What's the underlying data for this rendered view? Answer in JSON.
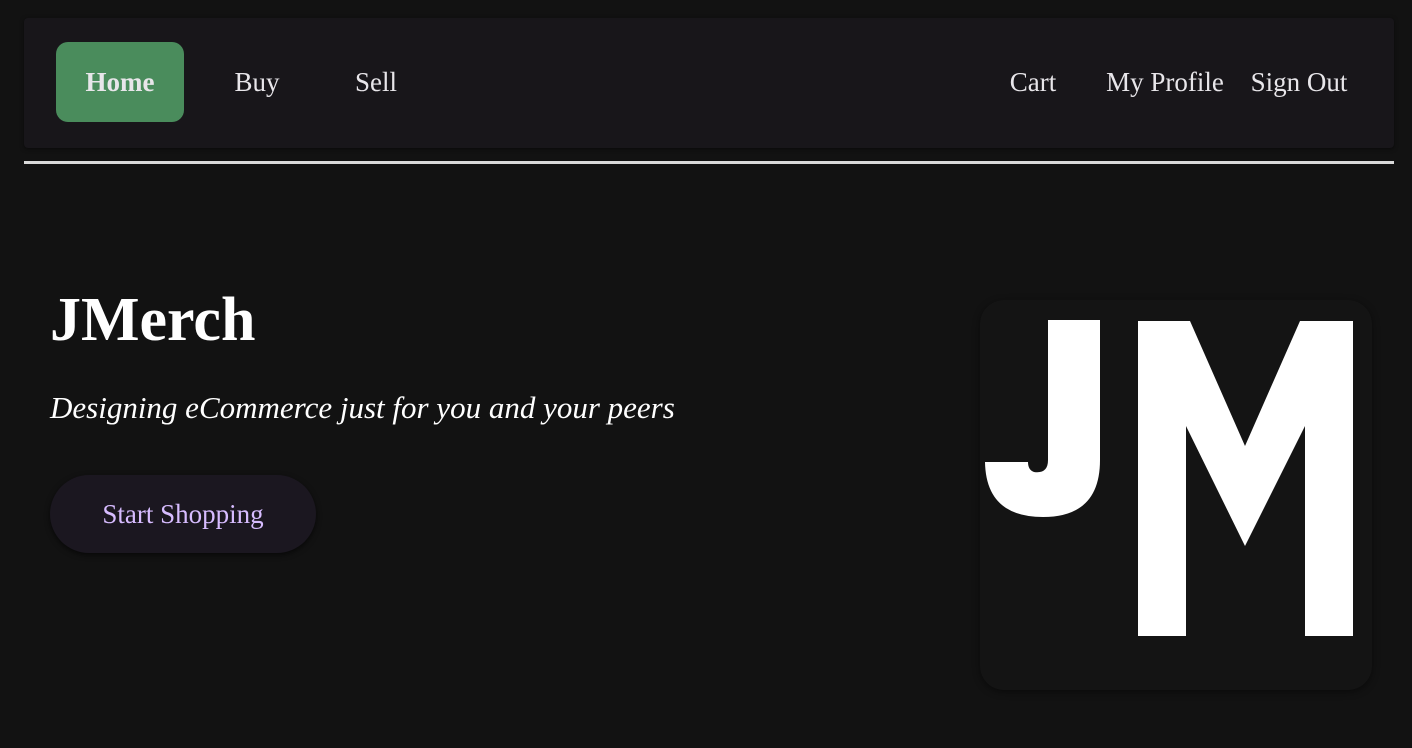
{
  "nav": {
    "home": "Home",
    "buy": "Buy",
    "sell": "Sell",
    "cart": "Cart",
    "profile": "My Profile",
    "sign_out": "Sign Out"
  },
  "hero": {
    "title": "JMerch",
    "subtitle": "Designing eCommerce just for you and your peers",
    "cta_label": "Start Shopping"
  },
  "logo": {
    "text": "JM"
  },
  "colors": {
    "background": "#121212",
    "nav_background": "#18161a",
    "active_nav": "#4a8c5c",
    "cta_text": "#d7bcff",
    "logo_fg": "#ffffff"
  }
}
